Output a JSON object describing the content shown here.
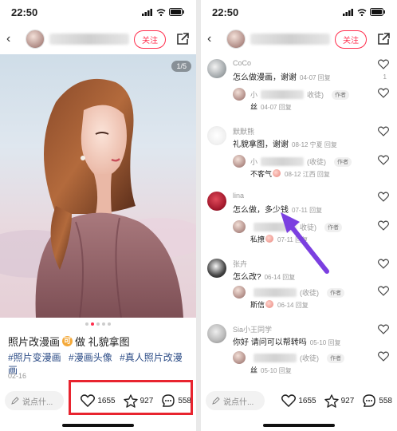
{
  "status": {
    "time": "22:50"
  },
  "nav": {
    "back": "‹",
    "follow_label": "关注"
  },
  "post": {
    "page_indicator": "1/5",
    "title_before": "照片改漫画",
    "title_coin": "可",
    "title_after": "做 礼貌拿图",
    "tags": [
      "#照片变漫画",
      "#漫画头像",
      "#真人照片改漫画"
    ],
    "date": "02-16"
  },
  "bottom": {
    "comment_placeholder": "说点什...",
    "likes": "1655",
    "stars": "927",
    "comments": "558"
  },
  "comments": [
    {
      "user": "CoCo",
      "text": "怎么做漫画，谢谢",
      "meta": "04-07 回复",
      "like_count": "1",
      "reply": {
        "name_prefix": "小",
        "name_suffix": "收徒)",
        "badge": "作者",
        "text_before": "丝",
        "text_after": "04-07 回复"
      }
    },
    {
      "user": "默默熊",
      "text": "礼貌拿图，谢谢",
      "meta": "08-12 宁夏 回复",
      "reply": {
        "name_prefix": "小",
        "name_suffix": "(收徒)",
        "badge": "作者",
        "text_before": "不客气",
        "text_after": "08-12 江西 回复"
      }
    },
    {
      "user": "lina",
      "text": "怎么做，多少钱",
      "meta": "07-11 回复",
      "reply": {
        "name_prefix": "",
        "name_suffix": "收徒)",
        "badge": "作者",
        "text_before": "私撩",
        "text_after": "07-11 回复"
      }
    },
    {
      "user": "张卉",
      "text": "怎么改?",
      "meta": "06-14 回复",
      "reply": {
        "name_prefix": "",
        "name_suffix": "(收徒)",
        "badge": "作者",
        "text_before": "斯信",
        "text_after": "06-14 回复"
      }
    },
    {
      "user": "Sia小王同学",
      "text": "你好 请问可以帮转吗",
      "meta": "05-10 回复",
      "reply": {
        "name_prefix": "",
        "name_suffix": "(收徒)",
        "badge": "作者",
        "text_before": "丝",
        "text_after": "05-10 回复"
      }
    }
  ],
  "colors": {
    "accent": "#ff2e4d",
    "tag": "#2d4d87",
    "highlight_box": "#e8242f",
    "arrow": "#7b3fe0"
  }
}
